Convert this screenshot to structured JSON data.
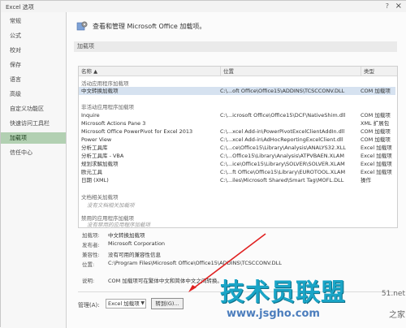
{
  "window": {
    "title": "Excel 选项",
    "help": "?",
    "close": "×"
  },
  "sidebar": {
    "items": [
      {
        "label": "常规",
        "active": false
      },
      {
        "label": "公式",
        "active": false
      },
      {
        "label": "校对",
        "active": false
      },
      {
        "label": "保存",
        "active": false
      },
      {
        "label": "语言",
        "active": false
      },
      {
        "label": "高级",
        "active": false
      },
      {
        "label": "自定义功能区",
        "active": false
      },
      {
        "label": "快速访问工具栏",
        "active": false
      },
      {
        "label": "加载项",
        "active": true
      },
      {
        "label": "信任中心",
        "active": false
      }
    ]
  },
  "main": {
    "header_text": "查看和管理 Microsoft Office 加载项。",
    "section_title": "加载项",
    "table": {
      "headers": {
        "name": "名称 ▲",
        "location": "位置",
        "type": "类型"
      },
      "groups": {
        "active": "活动应用程序加载项",
        "inactive": "非活动应用程序加载项",
        "document": "文档相关加载项",
        "disabled": "禁用的应用程序加载项"
      },
      "active_rows": [
        {
          "name": "中文转换加载项",
          "location": "C:\\...oft Office\\Office15\\ADDINS\\TCSCCONV.DLL",
          "type": "COM 加载项"
        }
      ],
      "inactive_rows": [
        {
          "name": "Inquire",
          "location": "C:\\...icrosoft Office\\Office15\\DCF\\NativeShim.dll",
          "type": "COM 加载项"
        },
        {
          "name": "Microsoft Actions Pane 3",
          "location": "",
          "type": "XML 扩展包"
        },
        {
          "name": "Microsoft Office PowerPivot for Excel 2013",
          "location": "C:\\...xcel Add-in\\PowerPivotExcelClientAddIn.dll",
          "type": "COM 加载项"
        },
        {
          "name": "Power View",
          "location": "C:\\...xcel Add-in\\AdHocReportingExcelClient.dll",
          "type": "COM 加载项"
        },
        {
          "name": "分析工具库",
          "location": "C:\\...ce\\Office15\\Library\\Analysis\\ANALYS32.XLL",
          "type": "Excel 加载项"
        },
        {
          "name": "分析工具库 - VBA",
          "location": "C:\\...Office15\\Library\\Analysis\\ATPVBAEN.XLAM",
          "type": "Excel 加载项"
        },
        {
          "name": "规划求解加载项",
          "location": "C:\\...ice\\Office15\\Library\\SOLVER\\SOLVER.XLAM",
          "type": "Excel 加载项"
        },
        {
          "name": "欧元工具",
          "location": "C:\\...ft Office\\Office15\\Library\\EUROTOOL.XLAM",
          "type": "Excel 加载项"
        },
        {
          "name": "日期 (XML)",
          "location": "C:\\...iles\\Microsoft Shared\\Smart Tag\\MOFL.DLL",
          "type": "操作"
        }
      ],
      "document_empty": "没有文档相关加载项",
      "disabled_empty": "没有禁用的应用程序加载项"
    },
    "details": {
      "addin_label": "加载项:",
      "addin_value": "中文转换加载项",
      "publisher_label": "发布者:",
      "publisher_value": "Microsoft Corporation",
      "compat_label": "兼容性:",
      "compat_value": "没有可用的兼容性信息",
      "location_label": "位置:",
      "location_value": "C:\\Program Files\\Microsoft Office\\Office15\\ADDINS\\TCSCCONV.DLL",
      "desc_label": "说明:",
      "desc_value": "COM 加载项可在繁体中文和简体中文之间转换。"
    },
    "manage": {
      "label": "管理(A):",
      "selected": "Excel 加载项",
      "goto_label": "转到(G)..."
    }
  },
  "watermark": {
    "brand": "技术员联盟",
    "url": "www.jsgho.com",
    "side_text": "51.net",
    "side_text2": "之家"
  },
  "colors": {
    "active_nav": "#b2d0b2",
    "selected_row": "#d6e2f0",
    "annotation_arrow": "#e02020",
    "watermark": "#1aa5c7"
  }
}
